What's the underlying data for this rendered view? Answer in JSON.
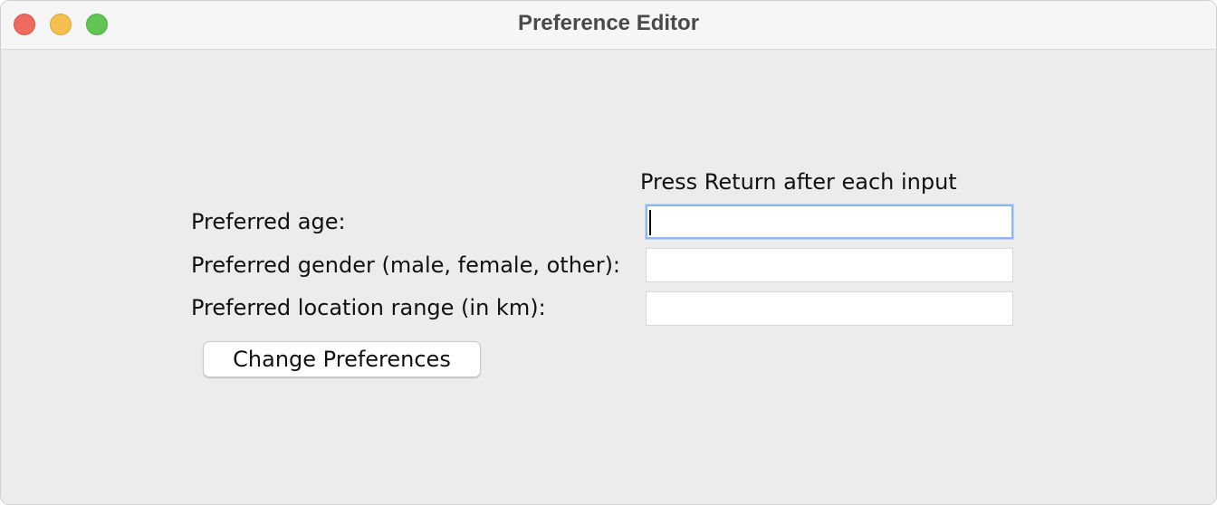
{
  "window": {
    "title": "Preference Editor"
  },
  "form": {
    "hint": "Press Return after each input",
    "age_label": "Preferred age:",
    "age_value": "",
    "gender_label": "Preferred gender (male, female, other):",
    "gender_value": "",
    "range_label": "Preferred location range (in km):",
    "range_value": "",
    "submit_label": "Change Preferences"
  },
  "colors": {
    "close": "#ed6a5e",
    "minimize": "#f5bf4f",
    "zoom": "#61c554",
    "focus_ring": "#8db8ef",
    "background": "#ececec"
  }
}
